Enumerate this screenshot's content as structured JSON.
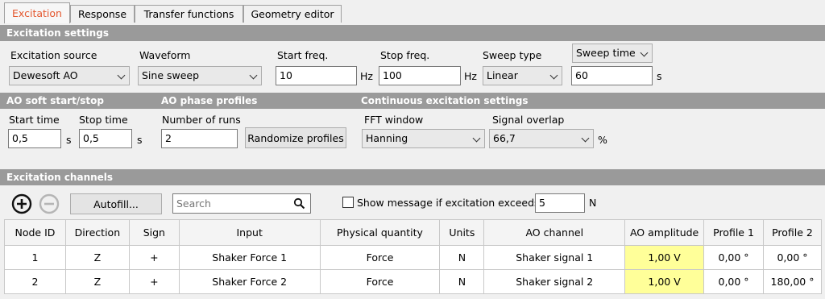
{
  "tabs": [
    {
      "label": "Excitation"
    },
    {
      "label": "Response"
    },
    {
      "label": "Transfer functions"
    },
    {
      "label": "Geometry editor"
    }
  ],
  "excitation_settings": {
    "header": "Excitation settings",
    "source_label": "Excitation source",
    "source_value": "Dewesoft AO",
    "waveform_label": "Waveform",
    "waveform_value": "Sine sweep",
    "start_freq_label": "Start freq.",
    "start_freq_value": "10",
    "start_freq_unit": "Hz",
    "stop_freq_label": "Stop freq.",
    "stop_freq_value": "100",
    "stop_freq_unit": "Hz",
    "sweep_type_label": "Sweep type",
    "sweep_type_value": "Linear",
    "sweep_time_select": "Sweep time",
    "sweep_time_value": "60",
    "sweep_time_unit": "s"
  },
  "soft_start": {
    "header": "AO soft start/stop",
    "start_label": "Start time",
    "start_value": "0,5",
    "start_unit": "s",
    "stop_label": "Stop time",
    "stop_value": "0,5",
    "stop_unit": "s"
  },
  "phase_profiles": {
    "header": "AO phase profiles",
    "runs_label": "Number of runs",
    "runs_value": "2",
    "randomize_label": "Randomize profiles"
  },
  "continuous": {
    "header": "Continuous excitation settings",
    "fft_label": "FFT window",
    "fft_value": "Hanning",
    "overlap_label": "Signal overlap",
    "overlap_value": "66,7",
    "overlap_unit": "%"
  },
  "channels": {
    "header": "Excitation channels",
    "autofill_label": "Autofill...",
    "search_placeholder": "Search",
    "show_message_label": "Show message if excitation exceeds",
    "exceed_value": "5",
    "exceed_unit": "N",
    "columns": [
      "Node ID",
      "Direction",
      "Sign",
      "Input",
      "Physical quantity",
      "Units",
      "AO channel",
      "AO amplitude",
      "Profile 1",
      "Profile 2"
    ],
    "rows": [
      [
        "1",
        "Z",
        "+",
        "Shaker Force 1",
        "Force",
        "N",
        "Shaker signal 1",
        "1,00 V",
        "0,00 °",
        "0,00 °"
      ],
      [
        "2",
        "Z",
        "+",
        "Shaker Force 2",
        "Force",
        "N",
        "Shaker signal 2",
        "1,00 V",
        "0,00 °",
        "180,00 °"
      ]
    ]
  }
}
